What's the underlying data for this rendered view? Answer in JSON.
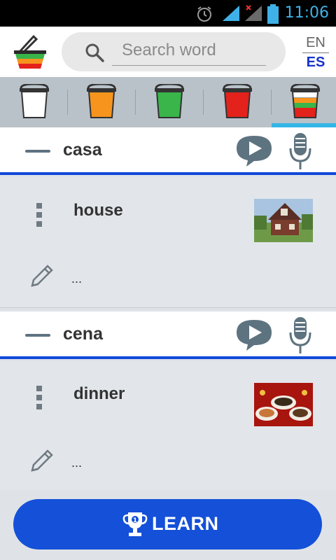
{
  "status_bar": {
    "time": "11:06"
  },
  "search": {
    "placeholder": "Search word"
  },
  "languages": {
    "source": "EN",
    "target": "ES"
  },
  "buckets": [
    {
      "name": "empty",
      "color": "#ffffff"
    },
    {
      "name": "orange",
      "color": "#f7941d"
    },
    {
      "name": "green",
      "color": "#39b54a"
    },
    {
      "name": "red",
      "color": "#e3221c"
    },
    {
      "name": "all",
      "color": "multicolor",
      "selected": true
    }
  ],
  "entries": [
    {
      "word": "casa",
      "translation": "house",
      "note": "...",
      "image": "house-photo"
    },
    {
      "word": "cena",
      "translation": "dinner",
      "note": "...",
      "image": "dinner-photo"
    }
  ],
  "learn_button": {
    "label": "LEARN"
  },
  "colors": {
    "accent": "#1450d8",
    "tab_indicator": "#33b5e5",
    "lang_active": "#1533cc"
  }
}
